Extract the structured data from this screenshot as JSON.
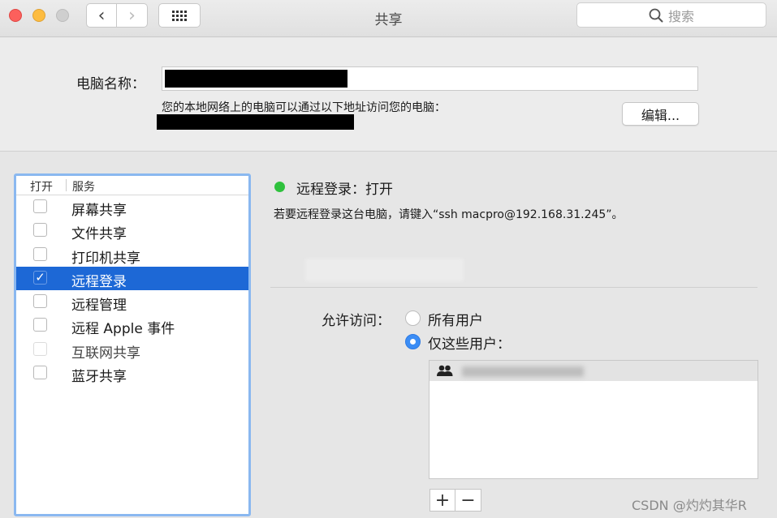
{
  "window": {
    "title": "共享"
  },
  "toolbar": {
    "search_placeholder": "搜索",
    "back": "‹",
    "forward": "›"
  },
  "computer_name": {
    "label": "电脑名称：",
    "address_description": "您的本地网络上的电脑可以通过以下地址访问您的电脑：",
    "edit_button": "编辑..."
  },
  "service_list": {
    "header_open": "打开",
    "header_service": "服务",
    "items": [
      {
        "label": "屏幕共享",
        "checked": false
      },
      {
        "label": "文件共享",
        "checked": false
      },
      {
        "label": "打印机共享",
        "checked": false
      },
      {
        "label": "远程登录",
        "checked": true,
        "selected": true
      },
      {
        "label": "远程管理",
        "checked": false
      },
      {
        "label": "远程 Apple 事件",
        "checked": false
      },
      {
        "label": "互联网共享",
        "checked": false
      },
      {
        "label": "蓝牙共享",
        "checked": false
      }
    ]
  },
  "detail": {
    "status_title": "远程登录：打开",
    "status_color": "#2fc13d",
    "status_description": "若要远程登录这台电脑，请键入“ssh macpro@192.168.31.245”。",
    "allow_access_label": "允许访问：",
    "option_all_users": "所有用户",
    "option_only_users": "仅这些用户：",
    "selected_option": "only_users",
    "add_button": "+",
    "remove_button": "−"
  },
  "watermark": "CSDN @灼灼其华R",
  "colors": {
    "accent": "#1d68d6",
    "list_focus": "#8ab8f0"
  }
}
